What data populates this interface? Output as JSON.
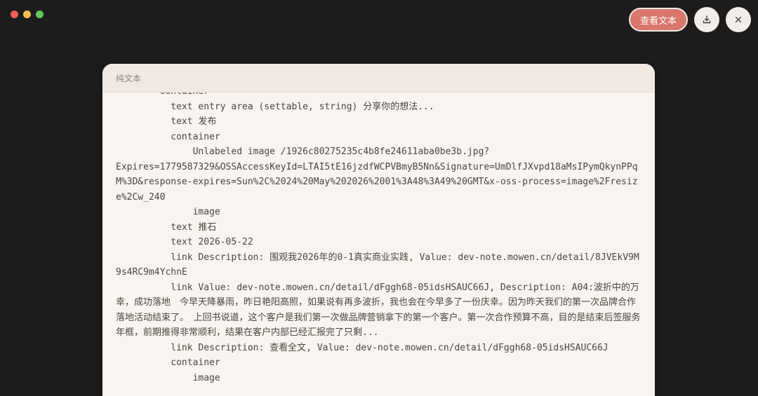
{
  "toolbar": {
    "view_text_label": "查看文本",
    "download_icon": "download-icon",
    "close_icon": "close-icon"
  },
  "panel": {
    "title": "纯文本",
    "lines": [
      "        container",
      "          text entry area (settable, string) 分享你的想法...",
      "          text 发布",
      "          container",
      "              Unlabeled image /1926c80275235c4b8fe24611aba0be3b.jpg?",
      "Expires=1779587329&OSSAccessKeyId=LTAI5tE16jzdfWCPVBmyB5Nn&Signature=UmDlfJXvpd18aMsIPymQkynPPqM%3D&response-expires=Sun%2C%2024%20May%202026%2001%3A48%3A49%20GMT&x-oss-process=image%2Fresize%2Cw_240",
      "              image",
      "          text 推石",
      "          text 2026-05-22",
      "          link Description: 围观我2026年的0-1真实商业实践, Value: dev-note.mowen.cn/detail/8JVEkV9M9s4RC9m4YchnE",
      "          link Value: dev-note.mowen.cn/detail/dFggh68-05idsHSAUC66J, Description: A04:波折中的万幸，成功落地　今早天降暴雨，昨日艳阳高照，如果说有再多波折，我也会在今早多了一份庆幸。因为昨天我们的第一次品牌合作落地活动结束了。　上回书说道，这个客户是我们第一次做品牌营销拿下的第一个客户。第一次合作预算不高，目的是结束后签服务年框，前期推得非常顺利，结果在客户内部已经汇报完了只剩...",
      "          link Description: 查看全文, Value: dev-note.mowen.cn/detail/dFggh68-05idsHSAUC66J",
      "          container",
      "              image"
    ]
  }
}
